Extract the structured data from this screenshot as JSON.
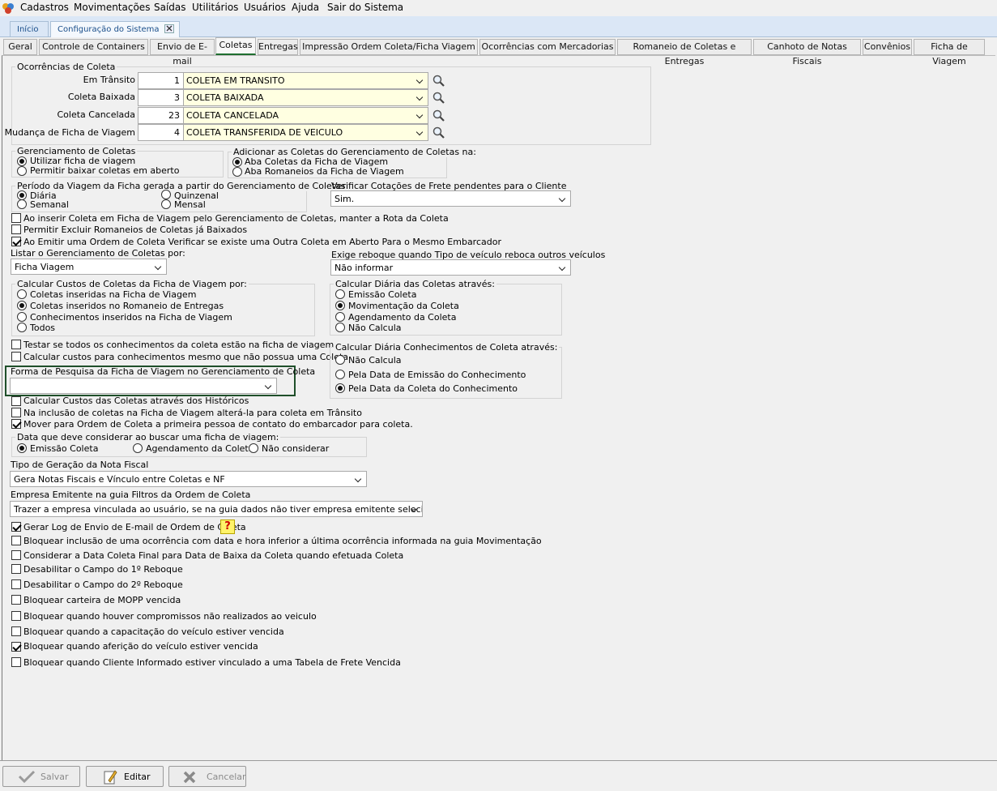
{
  "menu": [
    "Cadastros",
    "Movimentações",
    "Saídas",
    "Utilitários",
    "Usuários",
    "Ajuda",
    "Sair do Sistema"
  ],
  "doc_tabs": {
    "home": "Início",
    "config": "Configuração do Sistema"
  },
  "tabs": [
    "Geral",
    "Controle de Containers",
    "Envio de E-mail",
    "Coletas",
    "Entregas",
    "Impressão Ordem Coleta/Ficha Viagem",
    "Ocorrências com Mercadorias",
    "Romaneio de Coletas e Entregas",
    "Canhoto de Notas Fiscais",
    "Convênios",
    "Ficha de Viagem"
  ],
  "ocorrencias": {
    "title": "Ocorrências de Coleta",
    "rows": [
      {
        "label": "Em Trânsito",
        "code": "1",
        "value": "COLETA EM TRANSITO"
      },
      {
        "label": "Coleta Baixada",
        "code": "3",
        "value": "COLETA BAIXADA"
      },
      {
        "label": "Coleta Cancelada",
        "code": "23",
        "value": "COLETA CANCELADA"
      },
      {
        "label": "Mudança de Ficha de Viagem",
        "code": "4",
        "value": "COLETA TRANSFERIDA DE VEICULO"
      }
    ]
  },
  "gerenciamento": {
    "title": "Gerenciamento de Coletas",
    "opt1": "Utilizar ficha de viagem",
    "opt2": "Permitir baixar coletas em aberto"
  },
  "adicionar": {
    "title": "Adicionar as Coletas do Gerenciamento de Coletas na:",
    "opt1": "Aba Coletas da Ficha de Viagem",
    "opt2": "Aba Romaneios da Ficha de Viagem"
  },
  "periodo": {
    "title": "Período da Viagem da Ficha gerada a partir do Gerenciamento de Coletas",
    "diaria": "Diária",
    "semanal": "Semanal",
    "quinzenal": "Quinzenal",
    "mensal": "Mensal"
  },
  "verificar": {
    "label": "Verificar Cotações de Frete pendentes para o Cliente",
    "value": "Sim."
  },
  "checks1": [
    {
      "label": "Ao inserir Coleta em Ficha de Viagem pelo Gerenciamento de Coletas, manter a Rota da Coleta",
      "checked": false
    },
    {
      "label": "Permitir Excluir Romaneios de Coletas já Baixados",
      "checked": false
    },
    {
      "label": "Ao Emitir uma Ordem de Coleta Verificar se existe uma Outra Coleta em Aberto Para o Mesmo Embarcador",
      "checked": true
    }
  ],
  "listar": {
    "label": "Listar o Gerenciamento de Coletas por:",
    "value": "Ficha Viagem"
  },
  "reboque": {
    "label": "Exige reboque quando Tipo de veículo reboca outros veículos",
    "value": "Não informar"
  },
  "custos": {
    "title": "Calcular Custos de Coletas da Ficha de Viagem por:",
    "options": [
      "Coletas inseridas na Ficha de Viagem",
      "Coletas inseridos no Romaneio de Entregas",
      "Conhecimentos inseridos na Ficha de Viagem",
      "Todos"
    ]
  },
  "diaria": {
    "title": "Calcular Diária das Coletas através:",
    "options": [
      "Emissão Coleta",
      "Movimentação da Coleta",
      "Agendamento da Coleta",
      "Não Calcula"
    ]
  },
  "checks2": [
    {
      "label": "Testar se todos os conhecimentos da coleta estão na ficha de viagem",
      "checked": false
    },
    {
      "label": "Calcular custos para conhecimentos mesmo que não possua uma Coleta",
      "checked": false
    }
  ],
  "diaria_conh": {
    "title": "Calcular Diária Conhecimentos de Coleta através:",
    "options": [
      "Não Calcula",
      "Pela Data de Emissão do Conhecimento",
      "Pela Data da Coleta do Conhecimento"
    ]
  },
  "forma": {
    "label": "Forma de Pesquisa da Ficha de Viagem no Gerenciamento de Coleta",
    "value": ""
  },
  "checks3": [
    {
      "label": "Calcular Custos das Coletas através dos Históricos",
      "checked": false
    },
    {
      "label": "Na inclusão de coletas na Ficha de Viagem alterá-la para coleta em Trânsito",
      "checked": false
    },
    {
      "label": "Mover para Ordem de Coleta a primeira pessoa de contato do embarcador para coleta.",
      "checked": true
    }
  ],
  "data_busca": {
    "title": "Data que deve considerar ao buscar uma ficha de viagem:",
    "options": [
      "Emissão Coleta",
      "Agendamento da Coleta",
      "Não considerar"
    ]
  },
  "tipo_nf": {
    "label": "Tipo de Geração da Nota Fiscal",
    "value": "Gera Notas Fiscais e Vínculo entre Coletas e NF"
  },
  "empresa": {
    "label": "Empresa Emitente na guia Filtros da Ordem de Coleta",
    "value": "Trazer a empresa vinculada ao usuário, se na guia dados não tiver empresa emitente selecionada"
  },
  "checks4": [
    {
      "label": "Gerar Log de Envio de E-mail de Ordem de Coleta",
      "checked": true
    },
    {
      "label": "Bloquear inclusão de uma ocorrência com data e hora inferior a última ocorrência informada na guia Movimentação",
      "checked": false
    },
    {
      "label": "Considerar a Data Coleta Final para Data de Baixa da Coleta quando efetuada Coleta",
      "checked": false
    },
    {
      "label": "Desabilitar o Campo do 1º Reboque",
      "checked": false
    },
    {
      "label": "Desabilitar o Campo do 2º Reboque",
      "checked": false
    },
    {
      "label": "Bloquear carteira de MOPP vencida",
      "checked": false
    },
    {
      "label": "Bloquear quando houver compromissos não realizados ao veiculo",
      "checked": false
    },
    {
      "label": "Bloquear quando a capacitação do veículo estiver vencida",
      "checked": false
    },
    {
      "label": "Bloquear quando aferição do veículo estiver vencida",
      "checked": true
    },
    {
      "label": "Bloquear quando Cliente Informado estiver  vinculado a uma Tabela de Frete Vencida",
      "checked": false
    }
  ],
  "help": "?",
  "buttons": {
    "salvar": "Salvar",
    "editar": "Editar",
    "cancelar": "Cancelar"
  },
  "colors": {
    "accent": "#1f6f2f",
    "yellow_field": "#ffffe1",
    "tab_strip": "#dbe7f6"
  }
}
